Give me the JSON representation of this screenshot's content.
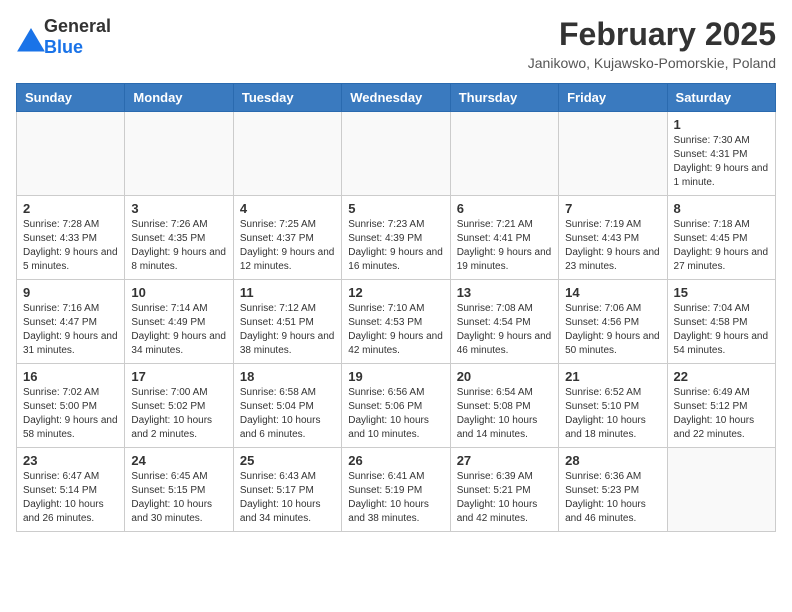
{
  "logo": {
    "general": "General",
    "blue": "Blue"
  },
  "title": "February 2025",
  "location": "Janikowo, Kujawsko-Pomorskie, Poland",
  "weekdays": [
    "Sunday",
    "Monday",
    "Tuesday",
    "Wednesday",
    "Thursday",
    "Friday",
    "Saturday"
  ],
  "weeks": [
    [
      {
        "day": "",
        "info": ""
      },
      {
        "day": "",
        "info": ""
      },
      {
        "day": "",
        "info": ""
      },
      {
        "day": "",
        "info": ""
      },
      {
        "day": "",
        "info": ""
      },
      {
        "day": "",
        "info": ""
      },
      {
        "day": "1",
        "info": "Sunrise: 7:30 AM\nSunset: 4:31 PM\nDaylight: 9 hours and 1 minute."
      }
    ],
    [
      {
        "day": "2",
        "info": "Sunrise: 7:28 AM\nSunset: 4:33 PM\nDaylight: 9 hours and 5 minutes."
      },
      {
        "day": "3",
        "info": "Sunrise: 7:26 AM\nSunset: 4:35 PM\nDaylight: 9 hours and 8 minutes."
      },
      {
        "day": "4",
        "info": "Sunrise: 7:25 AM\nSunset: 4:37 PM\nDaylight: 9 hours and 12 minutes."
      },
      {
        "day": "5",
        "info": "Sunrise: 7:23 AM\nSunset: 4:39 PM\nDaylight: 9 hours and 16 minutes."
      },
      {
        "day": "6",
        "info": "Sunrise: 7:21 AM\nSunset: 4:41 PM\nDaylight: 9 hours and 19 minutes."
      },
      {
        "day": "7",
        "info": "Sunrise: 7:19 AM\nSunset: 4:43 PM\nDaylight: 9 hours and 23 minutes."
      },
      {
        "day": "8",
        "info": "Sunrise: 7:18 AM\nSunset: 4:45 PM\nDaylight: 9 hours and 27 minutes."
      }
    ],
    [
      {
        "day": "9",
        "info": "Sunrise: 7:16 AM\nSunset: 4:47 PM\nDaylight: 9 hours and 31 minutes."
      },
      {
        "day": "10",
        "info": "Sunrise: 7:14 AM\nSunset: 4:49 PM\nDaylight: 9 hours and 34 minutes."
      },
      {
        "day": "11",
        "info": "Sunrise: 7:12 AM\nSunset: 4:51 PM\nDaylight: 9 hours and 38 minutes."
      },
      {
        "day": "12",
        "info": "Sunrise: 7:10 AM\nSunset: 4:53 PM\nDaylight: 9 hours and 42 minutes."
      },
      {
        "day": "13",
        "info": "Sunrise: 7:08 AM\nSunset: 4:54 PM\nDaylight: 9 hours and 46 minutes."
      },
      {
        "day": "14",
        "info": "Sunrise: 7:06 AM\nSunset: 4:56 PM\nDaylight: 9 hours and 50 minutes."
      },
      {
        "day": "15",
        "info": "Sunrise: 7:04 AM\nSunset: 4:58 PM\nDaylight: 9 hours and 54 minutes."
      }
    ],
    [
      {
        "day": "16",
        "info": "Sunrise: 7:02 AM\nSunset: 5:00 PM\nDaylight: 9 hours and 58 minutes."
      },
      {
        "day": "17",
        "info": "Sunrise: 7:00 AM\nSunset: 5:02 PM\nDaylight: 10 hours and 2 minutes."
      },
      {
        "day": "18",
        "info": "Sunrise: 6:58 AM\nSunset: 5:04 PM\nDaylight: 10 hours and 6 minutes."
      },
      {
        "day": "19",
        "info": "Sunrise: 6:56 AM\nSunset: 5:06 PM\nDaylight: 10 hours and 10 minutes."
      },
      {
        "day": "20",
        "info": "Sunrise: 6:54 AM\nSunset: 5:08 PM\nDaylight: 10 hours and 14 minutes."
      },
      {
        "day": "21",
        "info": "Sunrise: 6:52 AM\nSunset: 5:10 PM\nDaylight: 10 hours and 18 minutes."
      },
      {
        "day": "22",
        "info": "Sunrise: 6:49 AM\nSunset: 5:12 PM\nDaylight: 10 hours and 22 minutes."
      }
    ],
    [
      {
        "day": "23",
        "info": "Sunrise: 6:47 AM\nSunset: 5:14 PM\nDaylight: 10 hours and 26 minutes."
      },
      {
        "day": "24",
        "info": "Sunrise: 6:45 AM\nSunset: 5:15 PM\nDaylight: 10 hours and 30 minutes."
      },
      {
        "day": "25",
        "info": "Sunrise: 6:43 AM\nSunset: 5:17 PM\nDaylight: 10 hours and 34 minutes."
      },
      {
        "day": "26",
        "info": "Sunrise: 6:41 AM\nSunset: 5:19 PM\nDaylight: 10 hours and 38 minutes."
      },
      {
        "day": "27",
        "info": "Sunrise: 6:39 AM\nSunset: 5:21 PM\nDaylight: 10 hours and 42 minutes."
      },
      {
        "day": "28",
        "info": "Sunrise: 6:36 AM\nSunset: 5:23 PM\nDaylight: 10 hours and 46 minutes."
      },
      {
        "day": "",
        "info": ""
      }
    ]
  ]
}
